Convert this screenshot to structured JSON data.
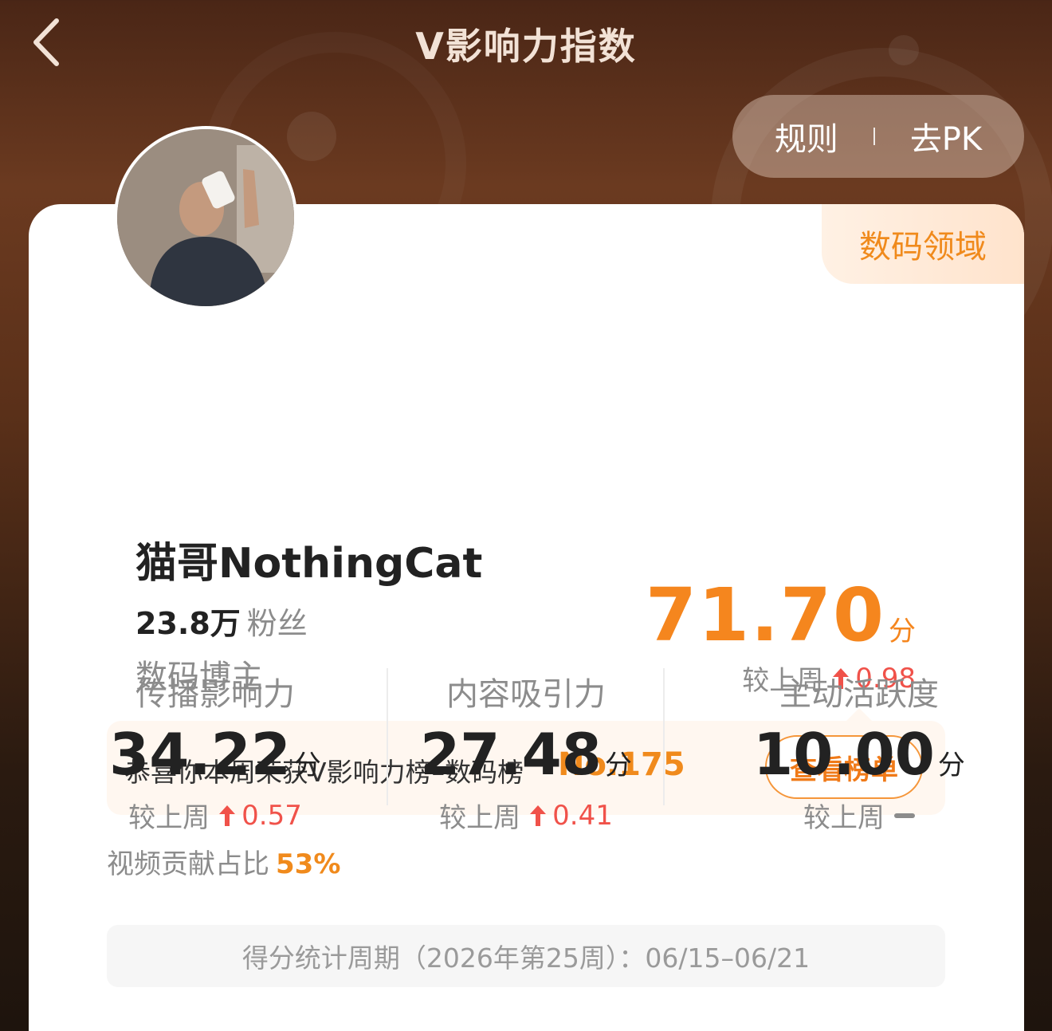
{
  "header": {
    "title": "V影响力指数",
    "rules_label": "规则",
    "pk_label": "去PK"
  },
  "profile": {
    "domain_tag": "数码领域",
    "username": "猫哥NothingCat",
    "fans_count": "23.8万",
    "fans_label": "粉丝",
    "role": "数码博主"
  },
  "score": {
    "total": "71.70",
    "unit": "分",
    "compare_label": "较上周",
    "delta": "0.98"
  },
  "rank": {
    "text": "恭喜你本周荣获V影响力榜–数码榜",
    "number": "No.175",
    "button_label": "查看榜单"
  },
  "metrics": [
    {
      "label": "传播影响力",
      "value": "34.22",
      "unit": "分",
      "compare_label": "较上周",
      "delta": "0.57",
      "trend": "up"
    },
    {
      "label": "内容吸引力",
      "value": "27.48",
      "unit": "分",
      "compare_label": "较上周",
      "delta": "0.41",
      "trend": "up"
    },
    {
      "label": "主动活跃度",
      "value": "10.00",
      "unit": "分",
      "compare_label": "较上周",
      "delta": "",
      "trend": "flat"
    }
  ],
  "video_share": {
    "label": "视频贡献占比",
    "value": "53%"
  },
  "period": {
    "text": "得分统计周期（2026年第25周）：06/15–06/21"
  },
  "colors": {
    "accent_orange": "#f5861e",
    "up_red": "#f0524a",
    "header_bg": "#5a3019"
  }
}
